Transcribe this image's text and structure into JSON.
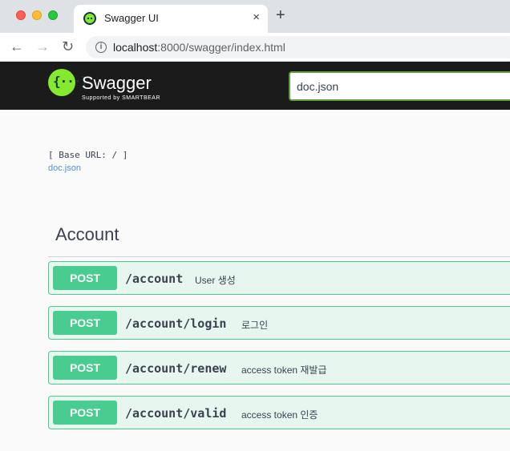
{
  "browser": {
    "tab_title": "Swagger UI",
    "tab_close": "×",
    "new_tab": "+",
    "url_host": "localhost",
    "url_rest": ":8000/swagger/index.html"
  },
  "swagger": {
    "logo_glyph": "{···}",
    "logo_text": "Swagger",
    "logo_sub": "Supported by SMARTBEAR",
    "search_value": "doc.json"
  },
  "info": {
    "base_url": "[ Base URL: / ]",
    "spec_link": "doc.json"
  },
  "section": {
    "title": "Account"
  },
  "operations": [
    {
      "method": "POST",
      "path": "/account",
      "summary": "User 생성"
    },
    {
      "method": "POST",
      "path": "/account/login",
      "summary": "로그인"
    },
    {
      "method": "POST",
      "path": "/account/renew",
      "summary": "access token 재발급"
    },
    {
      "method": "POST",
      "path": "/account/valid",
      "summary": "access token 인증"
    }
  ],
  "colors": {
    "post": "#49cc90",
    "post_bg": "#e8f6f0",
    "topbar": "#1b1b1b",
    "logo_green": "#85ea2d"
  }
}
